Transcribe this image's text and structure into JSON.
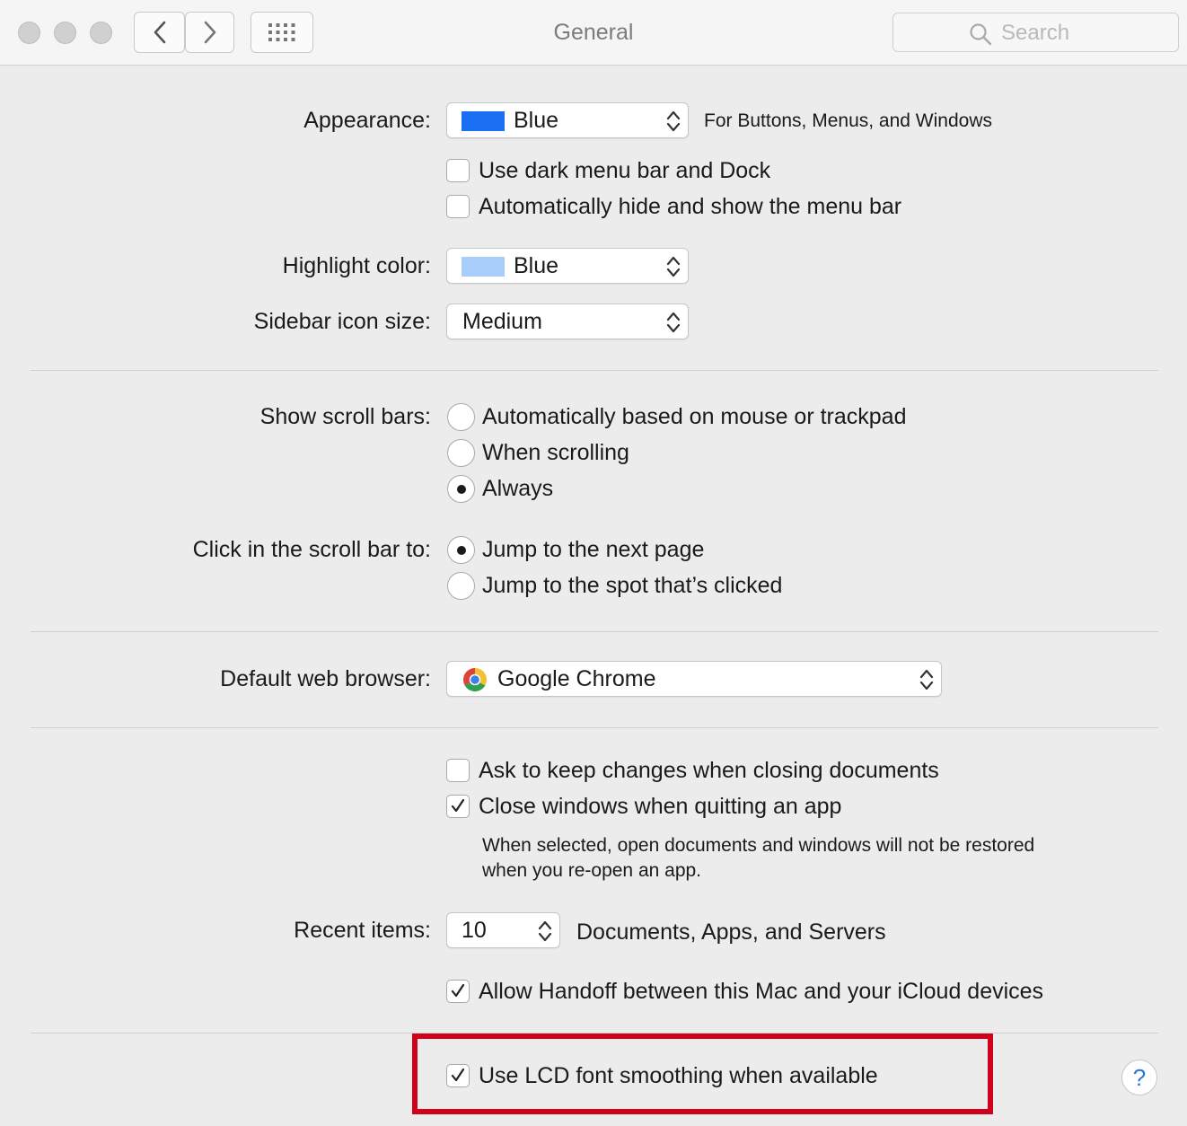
{
  "window": {
    "title": "General",
    "search_placeholder": "Search"
  },
  "appearance": {
    "label": "Appearance:",
    "value": "Blue",
    "swatch_color": "#1a6ff2",
    "note": "For Buttons, Menus, and Windows",
    "dark_menu_label": "Use dark menu bar and Dock",
    "dark_menu_checked": false,
    "autohide_label": "Automatically hide and show the menu bar",
    "autohide_checked": false
  },
  "highlight": {
    "label": "Highlight color:",
    "value": "Blue",
    "swatch_color": "#a9cdfb"
  },
  "sidebar_icon": {
    "label": "Sidebar icon size:",
    "value": "Medium"
  },
  "scroll_bars": {
    "label": "Show scroll bars:",
    "options": [
      "Automatically based on mouse or trackpad",
      "When scrolling",
      "Always"
    ],
    "selected": "Always"
  },
  "click_scroll": {
    "label": "Click in the scroll bar to:",
    "options": [
      "Jump to the next page",
      "Jump to the spot that’s clicked"
    ],
    "selected": "Jump to the next page"
  },
  "browser": {
    "label": "Default web browser:",
    "value": "Google Chrome"
  },
  "documents": {
    "ask_keep_label": "Ask to keep changes when closing documents",
    "ask_keep_checked": false,
    "close_windows_label": "Close windows when quitting an app",
    "close_windows_checked": true,
    "close_windows_note_line1": "When selected, open documents and windows will not be restored",
    "close_windows_note_line2": "when you re-open an app."
  },
  "recent": {
    "label": "Recent items:",
    "value": "10",
    "note": "Documents, Apps, and Servers"
  },
  "handoff": {
    "label": "Allow Handoff between this Mac and your iCloud devices",
    "checked": true
  },
  "lcd": {
    "label": "Use LCD font smoothing when available",
    "checked": true,
    "highlight_color": "#d0021b"
  },
  "help": {
    "symbol": "?"
  }
}
